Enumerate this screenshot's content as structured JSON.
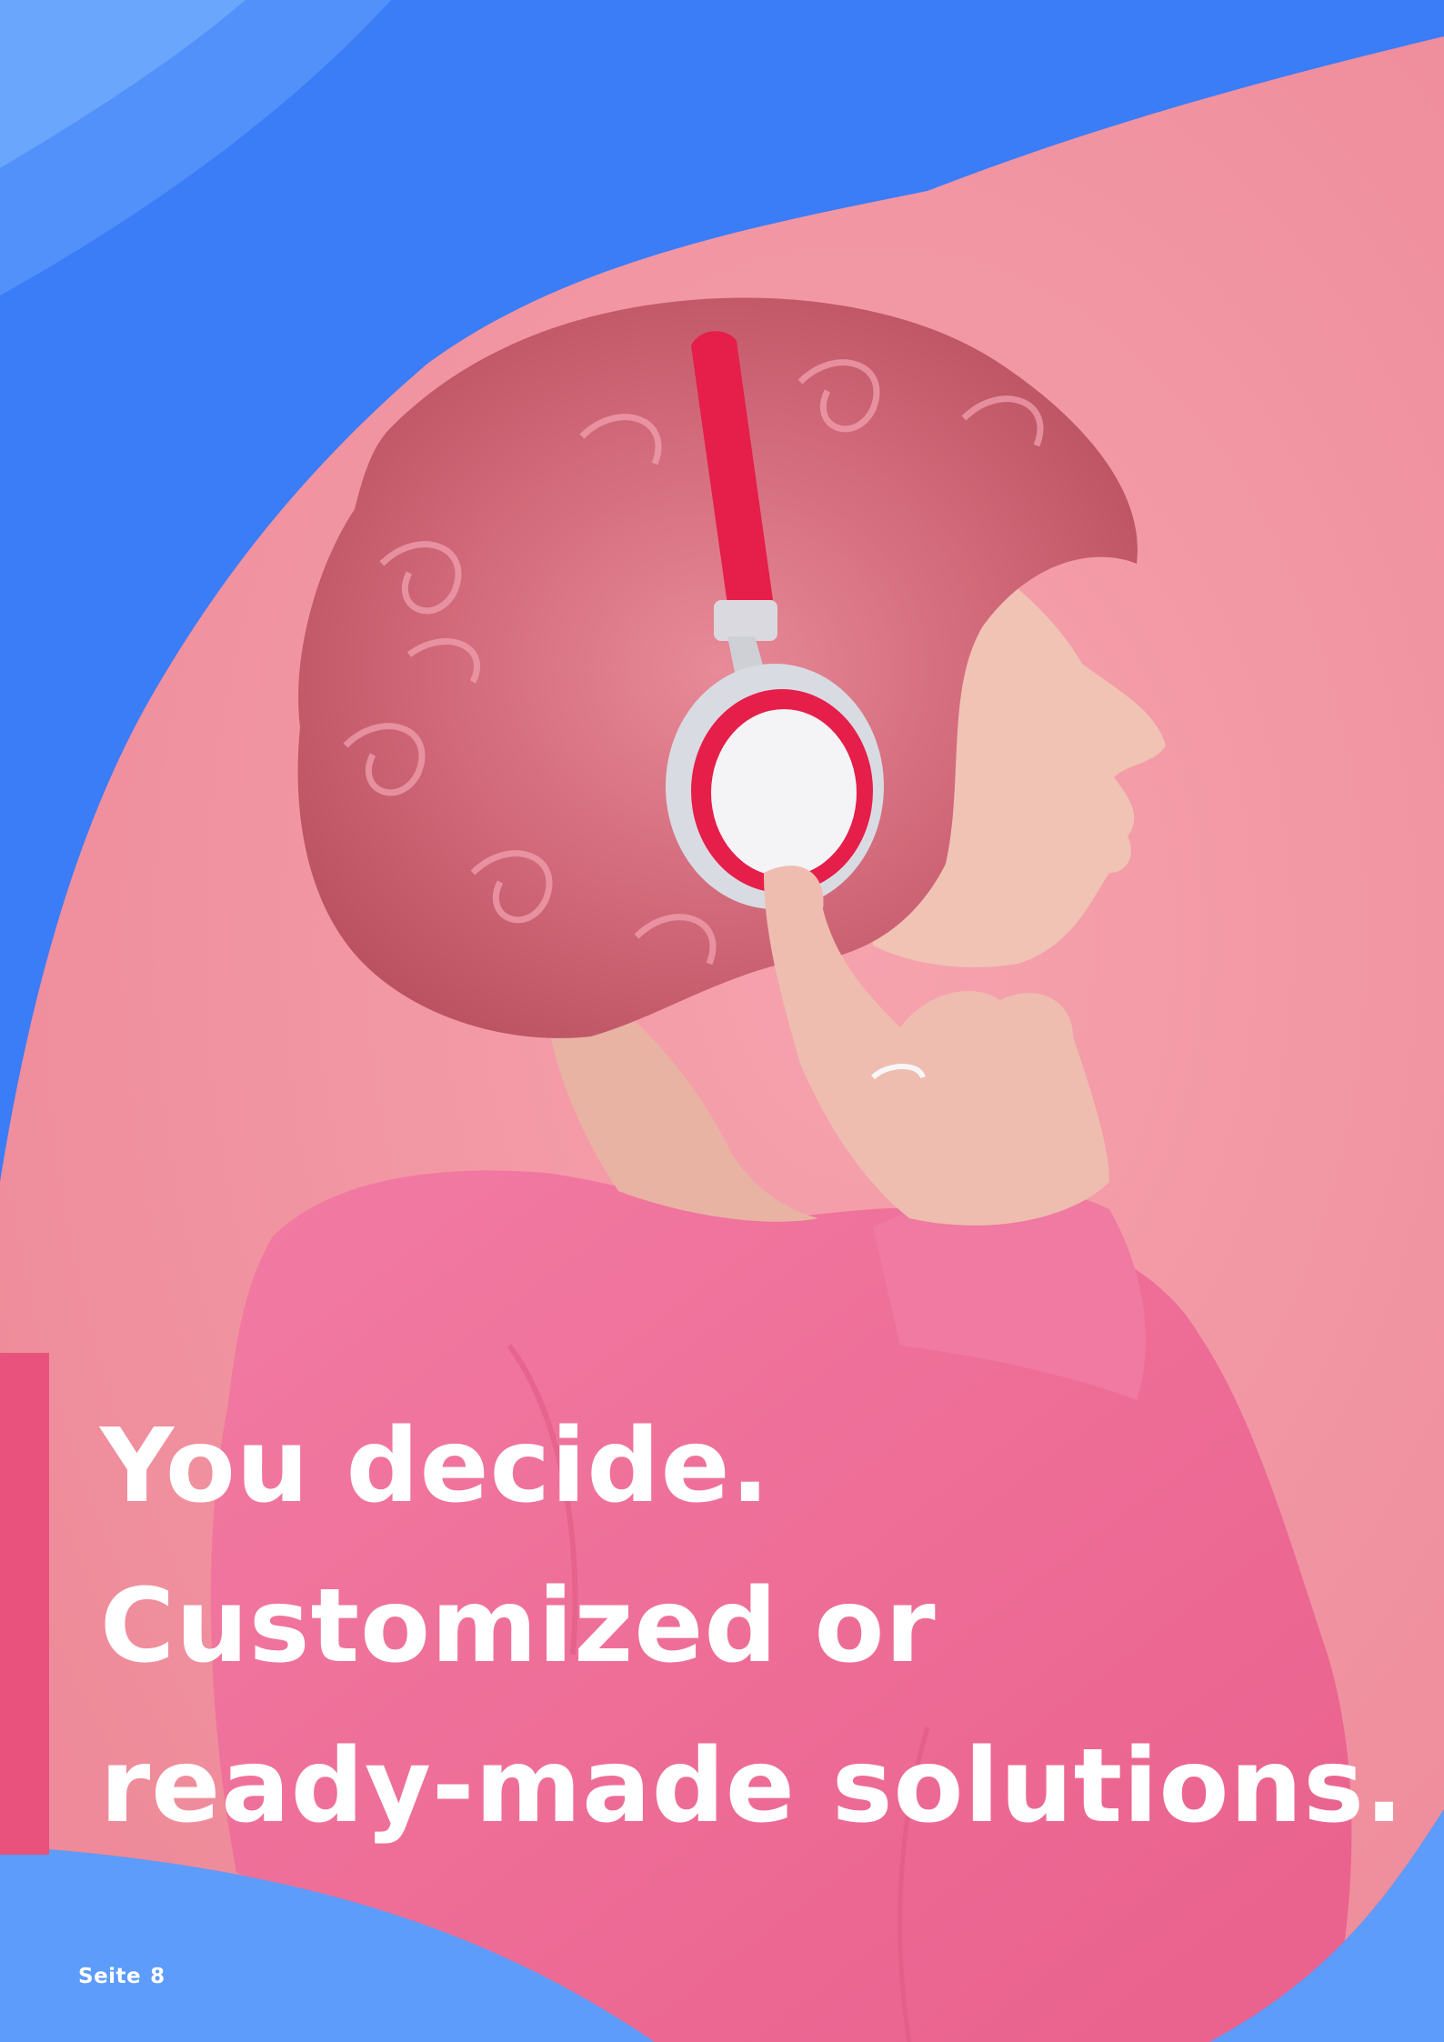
{
  "colors": {
    "background_blue": "#3b7cf7",
    "light_blue": "#6aa6fb",
    "pink_background": "#f2929f",
    "hoodie_pink": "#ef6e98",
    "hair": "#d56a7a",
    "headphone_red": "#e51e4a",
    "accent_bar": "#e8527c",
    "text": "#ffffff"
  },
  "photo": {
    "description_icon": "woman-with-headphones-photo"
  },
  "headline": {
    "line1": "You decide.",
    "line2": "Customized or",
    "line3": "ready-made solutions."
  },
  "footer": {
    "page_label": "Seite",
    "page_number": "8"
  }
}
